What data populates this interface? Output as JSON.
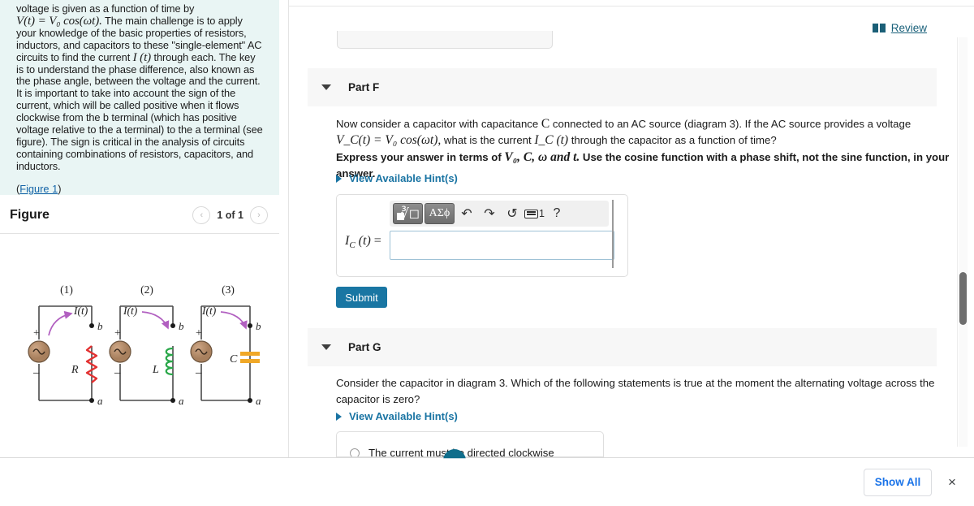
{
  "left_panel": {
    "intro_paragraph": "voltage is given as a function of time by V(t) = V₀ cos(ωt). The main challenge is to apply your knowledge of the basic properties of resistors, inductors, and capacitors to these \"single-element\" AC circuits to find the current I (t) through each. The key is to understand the phase difference, also known as the phase angle, between the voltage and the current. It is important to take into account the sign of the current, which will be called positive when it flows clockwise from the b terminal (which has positive voltage relative to the a terminal) to the a terminal (see figure). The sign is critical in the analysis of circuits containing combinations of resistors, capacitors, and inductors.",
    "intro_line_1": "voltage is given as a function of time by",
    "intro_math": "V(t) = V₀ cos(ωt).",
    "intro_rest_a": " The main challenge is to apply your knowledge of the basic properties of resistors, inductors, and capacitors to these \"single-element\" AC circuits to find the current ",
    "intro_math_2": "I (t)",
    "intro_rest_b": " through each. The key is to understand the phase difference, also known as the phase angle, between the voltage and the current. It is important to take into account the sign of the current, which will be called positive when it flows clockwise from the b terminal (which has positive voltage relative to the a terminal) to the a terminal (see figure). The sign is critical in the analysis of circuits containing combinations of resistors, capacitors, and inductors.",
    "figure_link_open": "(",
    "figure_link": "Figure 1",
    "figure_link_close": ")",
    "figure_title": "Figure",
    "nav_count": "1 of 1",
    "prev_arrow": "‹",
    "next_arrow": "›"
  },
  "figure": {
    "diagrams": [
      {
        "number": "(1)",
        "current_label": "I(t)",
        "element_label": "R",
        "element_type": "resistor",
        "terminal_top": "b",
        "terminal_bottom": "a",
        "source_plus": "+",
        "source_minus": "–"
      },
      {
        "number": "(2)",
        "current_label": "I(t)",
        "element_label": "L",
        "element_type": "inductor",
        "terminal_top": "b",
        "terminal_bottom": "a",
        "source_plus": "+",
        "source_minus": "–"
      },
      {
        "number": "(3)",
        "current_label": "I(t)",
        "element_label": "C",
        "element_type": "capacitor",
        "terminal_top": "b",
        "terminal_bottom": "a",
        "source_plus": "+",
        "source_minus": "–"
      }
    ],
    "colors": {
      "wire": "#4a4a4a",
      "arrow": "#b15fc0",
      "resistor": "#e03030",
      "inductor": "#2aa84a",
      "capacitor": "#f0a828",
      "source": "#b08668"
    }
  },
  "header": {
    "review_label": "Review",
    "review_icon": "book-icon"
  },
  "part_f": {
    "label": "Part F",
    "question_line_1": "Now consider a capacitor with capacitance C connected to an AC source (diagram 3). If the AC source provides a voltage",
    "question_pre_c": "Now consider a capacitor with capacitance ",
    "question_c": "C",
    "question_post_c": " connected to an AC source (diagram 3). If the AC source provides a voltage",
    "question_math_vc": "V_C(t) = V₀ cos(ωt),",
    "question_mid": " what is the current ",
    "question_math_ic": "I_C (t)",
    "question_end": " through the capacitor as a function of time?",
    "instruction_pre": "Express your answer in terms of ",
    "instruction_vars": "V₀, C, ω and t.",
    "instruction_post": " Use the cosine function with a phase shift, not the sine function, in your answer.",
    "hint_label": "View Available Hint(s)",
    "answer_label": "I_C (t) =",
    "answer_value": "",
    "answer_placeholder": "",
    "submit_label": "Submit",
    "toolbar": {
      "template_button": "math-template-button",
      "greek_button": "ΑΣϕ",
      "undo": "↶",
      "redo": "↷",
      "reset": "↺",
      "keyboard_number": "1",
      "help": "?"
    }
  },
  "part_g": {
    "label": "Part G",
    "question": "Consider the capacitor in diagram 3. Which of the following statements is true at the moment the alternating voltage across the capacitor is zero?",
    "hint_label": "View Available Hint(s)",
    "choices": [
      {
        "text": "The current must be directed clockwise",
        "selected": false
      }
    ]
  },
  "bottom_bar": {
    "show_all_label": "Show All",
    "close_label": "×"
  },
  "colors": {
    "accent_teal": "#19607a",
    "link_blue": "#1a74a3",
    "submit_blue": "#1976a3",
    "google_blue": "#1a73e8",
    "intro_bg": "#e9f5f4",
    "part_header_bg": "#f7f7f7"
  }
}
